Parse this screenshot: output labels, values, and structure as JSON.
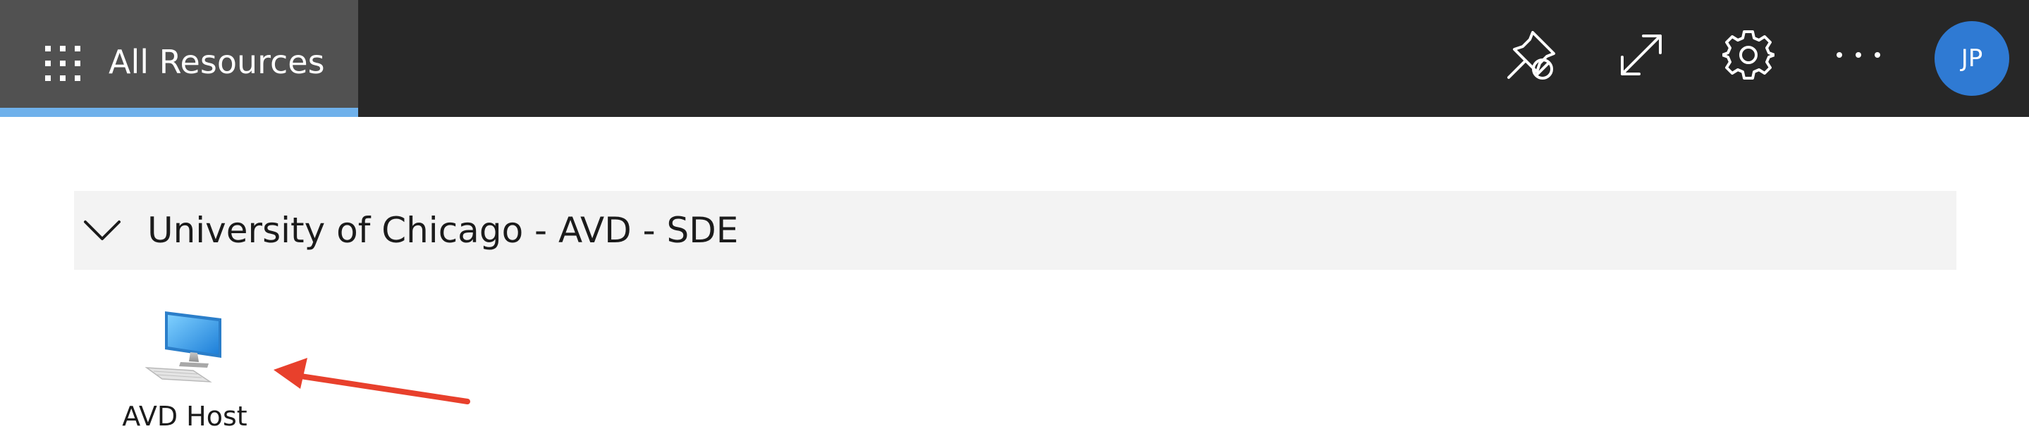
{
  "header": {
    "title": "All Resources",
    "waffle_icon": "app-launcher-icon",
    "toolbar": [
      {
        "icon": "unpin-icon"
      },
      {
        "icon": "expand-icon"
      },
      {
        "icon": "gear-icon"
      },
      {
        "icon": "more-icon"
      }
    ],
    "avatar_initials": "JP",
    "colors": {
      "bar": "#272727",
      "active_tab": "#515151",
      "active_underline": "#6fb1eb",
      "avatar": "#2f7ad3"
    }
  },
  "group": {
    "title": "University of Chicago - AVD - SDE",
    "expanded": true,
    "resources": [
      {
        "label": "AVD Host",
        "icon": "desktop-computer-icon"
      }
    ]
  },
  "annotation": {
    "arrow_color": "#e8402c"
  }
}
